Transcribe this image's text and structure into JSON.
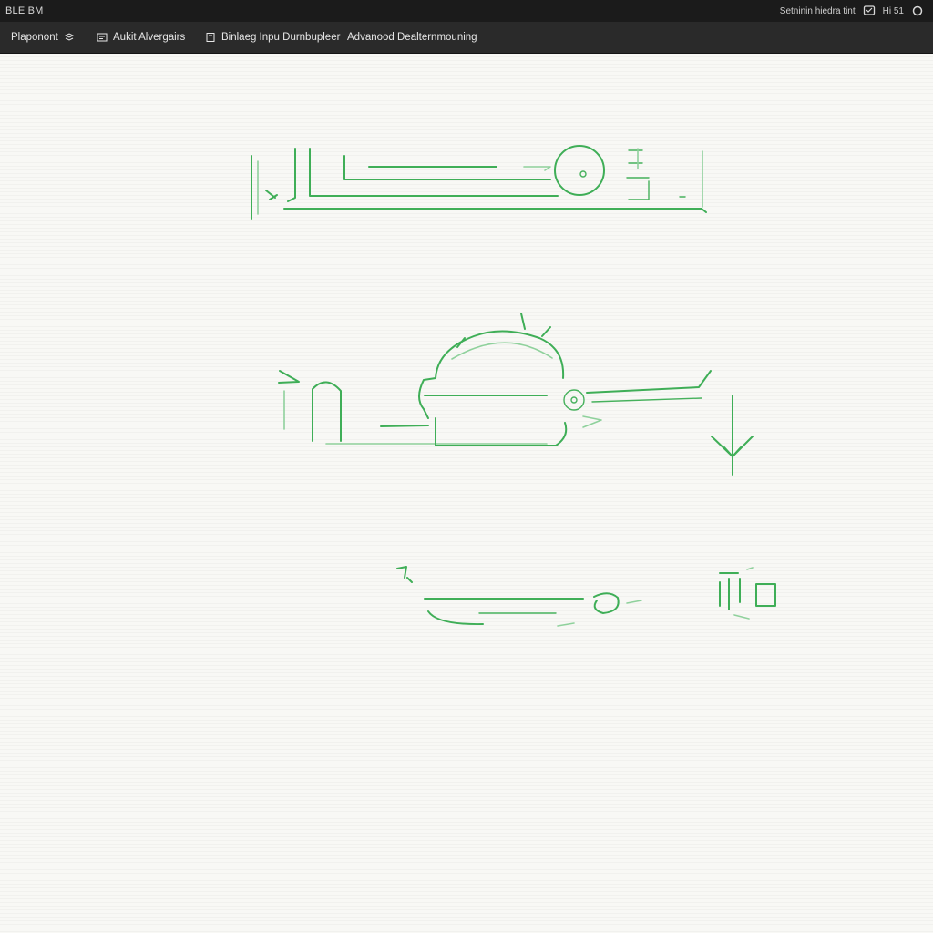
{
  "window": {
    "app_title": "BLE BM",
    "status_text": "Setninin hiedra tint",
    "indicator_label": "Hi 51"
  },
  "toolbar": {
    "tools": [
      {
        "label": "Plaponont",
        "icon": "layers-icon"
      },
      {
        "label": "Aukit Alvergairs",
        "icon": "panel-icon"
      },
      {
        "label": "Binlaeg Inpu Durnbupleer",
        "icon": "document-icon"
      },
      {
        "label": "Advanood Dealternmouning",
        "icon": ""
      }
    ]
  },
  "colors": {
    "sketch_stroke": "#3fae57",
    "titlebar_bg": "#1b1b1b",
    "toolbar_bg": "#2a2a2a",
    "canvas_bg": "#f7f7f4"
  }
}
